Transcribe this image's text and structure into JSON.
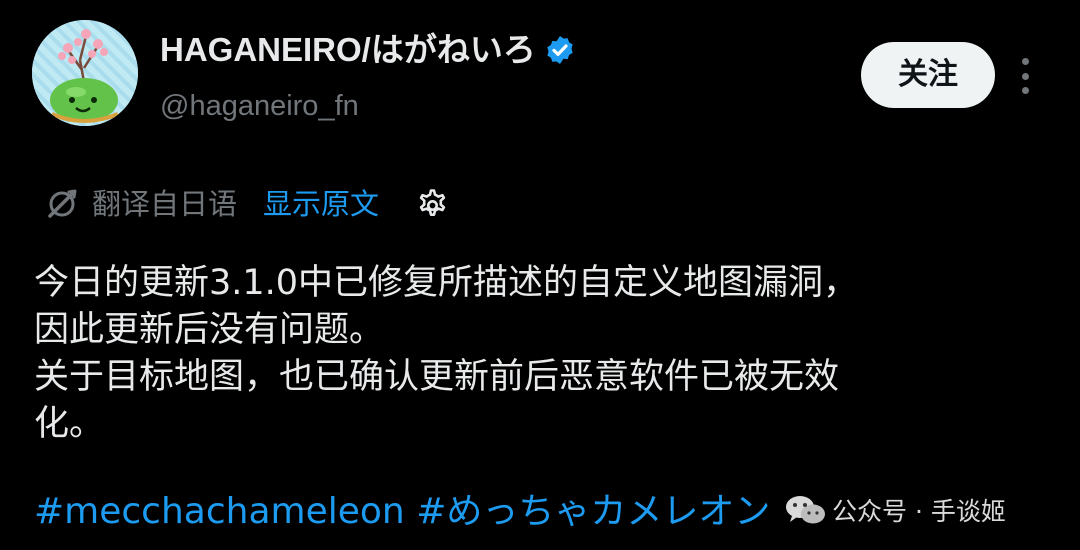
{
  "author": {
    "display_name": "HAGANEIRO/はがねいろ",
    "handle": "@haganeiro_fn",
    "verified_icon": "verified-badge-icon",
    "avatar_icon": "avatar-slime-sakura"
  },
  "actions": {
    "follow_label": "关注",
    "more_icon": "more-vertical-icon"
  },
  "translation": {
    "translated_from": "翻译自日语",
    "show_original": "显示原文",
    "translate_icon": "translate-icon",
    "settings_icon": "gear-icon"
  },
  "tweet": {
    "lines": [
      "今日的更新3.1.0中已修复所描述的自定义地图漏洞，",
      "因此更新后没有问题。",
      "关于目标地图，也已确认更新前后恶意软件已被无效",
      "化。"
    ],
    "hashtags": [
      "#mecchachameleon",
      "#めっちゃカメレオン"
    ]
  },
  "watermark": {
    "text": "公众号 · 手谈姬",
    "icon": "wechat-icon"
  },
  "colors": {
    "background": "#000000",
    "text": "#e7e9ea",
    "secondary": "#71767b",
    "link": "#1d9bf0",
    "follow_button_bg": "#eff3f4",
    "verified": "#1d9bf0"
  }
}
